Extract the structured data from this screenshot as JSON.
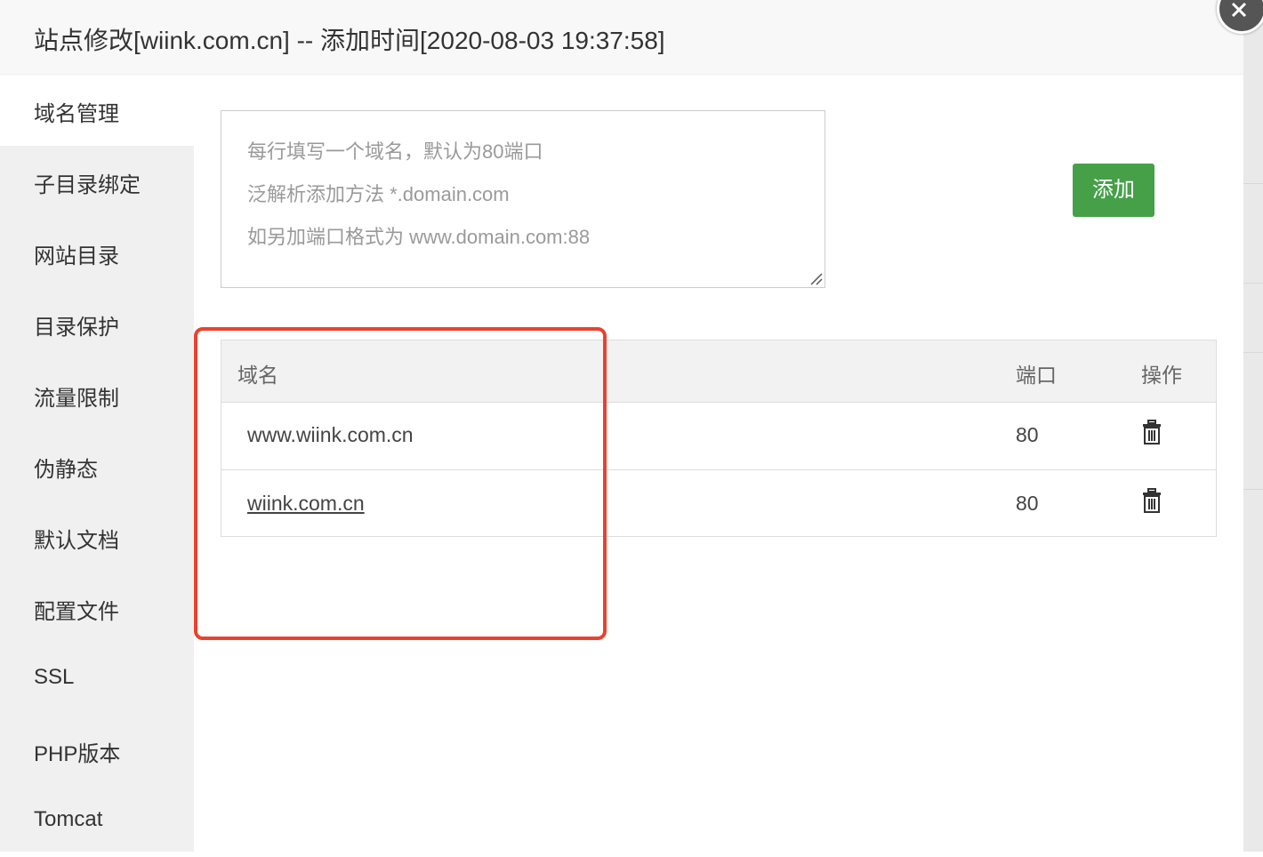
{
  "title": "站点修改[wiink.com.cn] -- 添加时间[2020-08-03 19:37:58]",
  "sidebar": {
    "items": [
      {
        "label": "域名管理",
        "active": true
      },
      {
        "label": "子目录绑定"
      },
      {
        "label": "网站目录"
      },
      {
        "label": "目录保护"
      },
      {
        "label": "流量限制"
      },
      {
        "label": "伪静态"
      },
      {
        "label": "默认文档"
      },
      {
        "label": "配置文件"
      },
      {
        "label": "SSL"
      },
      {
        "label": "PHP版本"
      },
      {
        "label": "Tomcat"
      }
    ]
  },
  "domain_input": {
    "placeholder_lines": [
      "每行填写一个域名，默认为80端口",
      "泛解析添加方法 *.domain.com",
      "如另加端口格式为 www.domain.com:88"
    ]
  },
  "add_button": "添加",
  "table": {
    "headers": {
      "domain": "域名",
      "port": "端口",
      "action": "操作"
    },
    "rows": [
      {
        "domain": "www.wiink.com.cn",
        "port": "80"
      },
      {
        "domain": "wiink.com.cn",
        "port": "80"
      }
    ]
  },
  "colors": {
    "accent_green": "#45a047",
    "highlight_red": "#e8432f"
  },
  "icons": {
    "close": "close-icon",
    "delete": "trash-icon",
    "resize": "resize-grip-icon"
  }
}
